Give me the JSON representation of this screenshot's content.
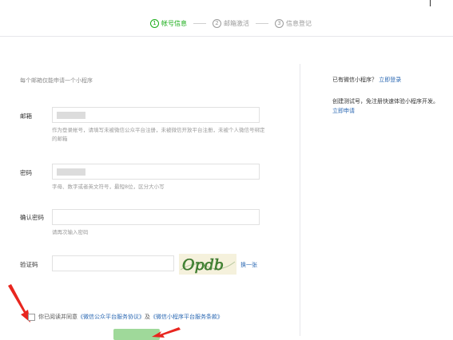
{
  "steps": [
    {
      "num": "1",
      "label": "帐号信息"
    },
    {
      "num": "2",
      "label": "邮箱激活"
    },
    {
      "num": "3",
      "label": "信息登记"
    }
  ],
  "tip": "每个邮箱仅能申请一个小程序",
  "form": {
    "email": {
      "label": "邮箱",
      "hint": "作为登录帐号，请填写未被微信公众平台注册，未被微信开放平台注册，未被个人微信号绑定的邮箱"
    },
    "password": {
      "label": "密码",
      "hint": "字母、数字或者英文符号，最短8位，区分大小写"
    },
    "confirm": {
      "label": "确认密码",
      "hint": "请再次输入密码"
    },
    "captcha": {
      "label": "验证码",
      "image_text": "Opdb",
      "refresh_label": "换一张"
    }
  },
  "agreement": {
    "prefix": "你已阅读并同意",
    "link1": "《微信公众平台服务协议》",
    "connector": "及",
    "link2": "《微信小程序平台服务条款》"
  },
  "sidebar": {
    "have_account": "已有微信小程序？",
    "login_link": "立即登录",
    "desc": "创建测试号，免注册快速体验小程序开发。",
    "apply_link": "立即申请"
  },
  "colors": {
    "accent": "#1aad19",
    "link": "#2c69b3",
    "annotation": "#e8261f"
  }
}
